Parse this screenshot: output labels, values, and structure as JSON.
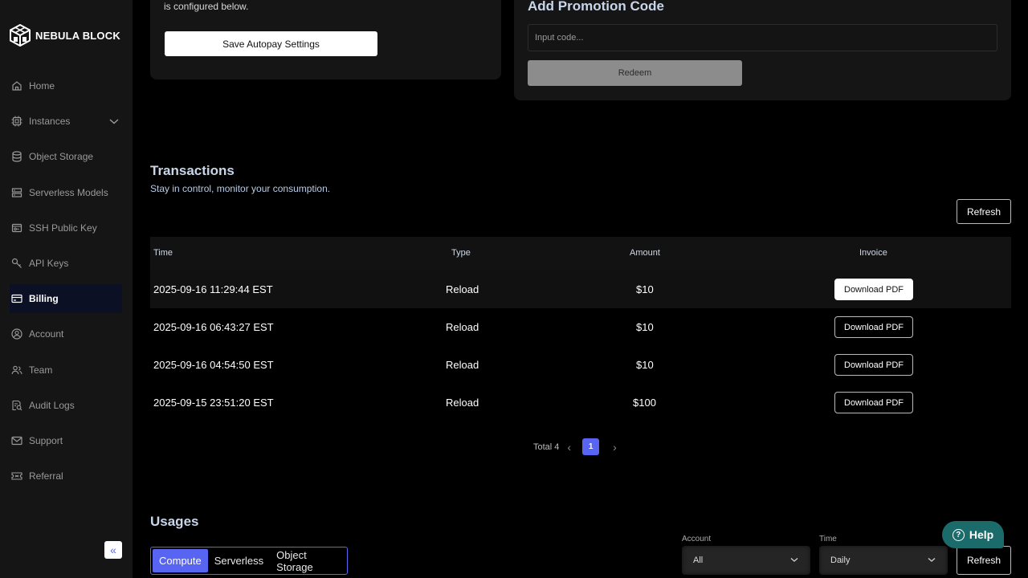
{
  "sidebar": {
    "brand": "NEBULA BLOCK",
    "items": [
      {
        "label": "Home",
        "icon": "home-icon"
      },
      {
        "label": "Instances",
        "icon": "chip-icon"
      },
      {
        "label": "Object Storage",
        "icon": "database-icon"
      },
      {
        "label": "Serverless Models",
        "icon": "server-icon"
      },
      {
        "label": "SSH Public Key",
        "icon": "ssh-key-icon"
      },
      {
        "label": "API Keys",
        "icon": "key-icon"
      },
      {
        "label": "Billing",
        "icon": "credit-card-icon"
      },
      {
        "label": "Account",
        "icon": "user-circle-icon"
      },
      {
        "label": "Team",
        "icon": "team-icon"
      },
      {
        "label": "Audit Logs",
        "icon": "audit-icon"
      },
      {
        "label": "Support",
        "icon": "mail-icon"
      },
      {
        "label": "Referral",
        "icon": "ticket-icon"
      }
    ],
    "active": "Billing",
    "collapse_glyph": "«"
  },
  "autopay": {
    "text": "is configured below.",
    "save_label": "Save Autopay Settings"
  },
  "promotion": {
    "title": "Add Promotion Code",
    "placeholder": "Input code...",
    "redeem_label": "Redeem"
  },
  "transactions": {
    "title": "Transactions",
    "subtitle": "Stay in control, monitor your consumption.",
    "refresh_label": "Refresh",
    "columns": [
      "Time",
      "Type",
      "Amount",
      "Invoice"
    ],
    "rows": [
      {
        "time": "2025-09-16 11:29:44 EST",
        "type": "Reload",
        "amount": "$10",
        "invoice": "Download PDF"
      },
      {
        "time": "2025-09-16 06:43:27 EST",
        "type": "Reload",
        "amount": "$10",
        "invoice": "Download PDF"
      },
      {
        "time": "2025-09-16 04:54:50 EST",
        "type": "Reload",
        "amount": "$10",
        "invoice": "Download PDF"
      },
      {
        "time": "2025-09-15 23:51:20 EST",
        "type": "Reload",
        "amount": "$100",
        "invoice": "Download PDF"
      }
    ],
    "pagination": {
      "total": "Total 4",
      "current": "1",
      "prev": "‹",
      "next": "›"
    }
  },
  "usages": {
    "title": "Usages",
    "tabs": [
      "Compute",
      "Serverless",
      "Object Storage"
    ],
    "active_tab": "Compute",
    "account_label": "Account",
    "account_value": "All",
    "time_label": "Time",
    "time_value": "Daily",
    "refresh_label": "Refresh"
  },
  "help": {
    "label": "Help",
    "glyph": "?"
  },
  "colors": {
    "accent": "#5865f2",
    "help": "#1c6b6b",
    "background": "#000000",
    "sidebar": "#151515"
  }
}
